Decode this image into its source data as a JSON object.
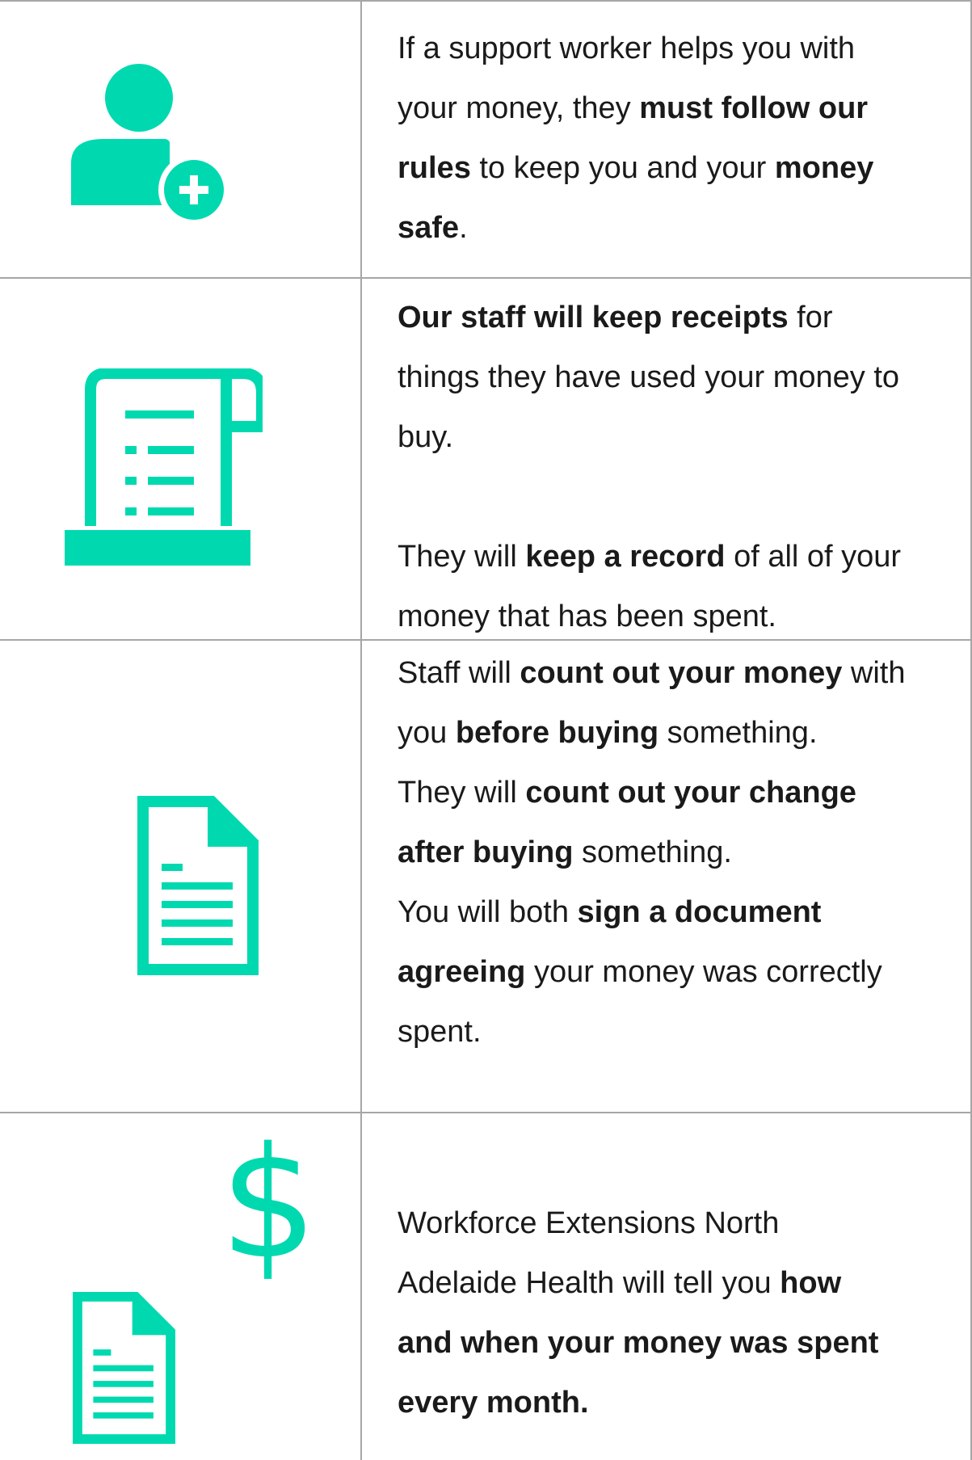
{
  "colors": {
    "accent": "#00d9b0",
    "grid": "#a6a6a6",
    "text": "#1a1a1a"
  },
  "rows": [
    {
      "icon": "user-add-icon",
      "segments": [
        {
          "t": "If a support worker helps you with",
          "b": false,
          "br": true
        },
        {
          "t": "your money, they ",
          "b": false
        },
        {
          "t": "must follow our",
          "b": true,
          "br": true
        },
        {
          "t": "rules",
          "b": true
        },
        {
          "t": " to keep you and your ",
          "b": false
        },
        {
          "t": "money",
          "b": true,
          "br": true
        },
        {
          "t": "safe",
          "b": true
        },
        {
          "t": ".",
          "b": false
        }
      ]
    },
    {
      "icon": "receipt-scroll-icon",
      "segments": [
        {
          "t": "Our staff will keep receipts",
          "b": true
        },
        {
          "t": " for",
          "b": false,
          "br": true
        },
        {
          "t": "things they have used your money to",
          "b": false,
          "br": true
        },
        {
          "t": "buy.",
          "b": false,
          "br": true
        },
        {
          "t": "",
          "b": false,
          "br": true
        },
        {
          "t": "They will ",
          "b": false
        },
        {
          "t": "keep a record",
          "b": true
        },
        {
          "t": " of all of your",
          "b": false,
          "br": true
        },
        {
          "t": "money that has been spent.",
          "b": false
        }
      ]
    },
    {
      "icon": "document-icon",
      "segments": [
        {
          "t": "Staff will ",
          "b": false
        },
        {
          "t": "count out your money",
          "b": true
        },
        {
          "t": " with",
          "b": false,
          "br": true
        },
        {
          "t": "you ",
          "b": false
        },
        {
          "t": "before buying",
          "b": true
        },
        {
          "t": " something.",
          "b": false,
          "br": true
        },
        {
          "t": "They will ",
          "b": false
        },
        {
          "t": "count out your change",
          "b": true,
          "br": true
        },
        {
          "t": "after buying",
          "b": true
        },
        {
          "t": " something.",
          "b": false,
          "br": true
        },
        {
          "t": "You will both ",
          "b": false
        },
        {
          "t": "sign a document",
          "b": true,
          "br": true
        },
        {
          "t": "agreeing",
          "b": true
        },
        {
          "t": " your money was correctly",
          "b": false,
          "br": true
        },
        {
          "t": "spent.",
          "b": false
        }
      ]
    },
    {
      "icon": "money-statement-icon",
      "dollar_symbol": "$",
      "segments": [
        {
          "t": "Workforce Extensions  North",
          "b": false,
          "br": true
        },
        {
          "t": "Adelaide Health will tell you ",
          "b": false
        },
        {
          "t": "how",
          "b": true,
          "br": true
        },
        {
          "t": "and when your money was spent",
          "b": true,
          "br": true
        },
        {
          "t": "every month.",
          "b": true
        }
      ]
    }
  ]
}
